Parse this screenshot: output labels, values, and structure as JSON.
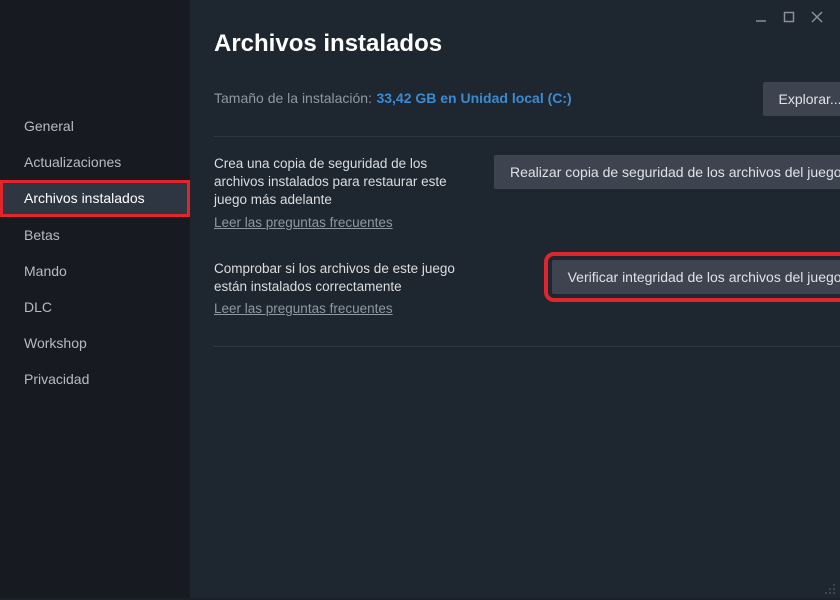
{
  "sidebar": {
    "items": [
      {
        "label": "General"
      },
      {
        "label": "Actualizaciones"
      },
      {
        "label": "Archivos instalados"
      },
      {
        "label": "Betas"
      },
      {
        "label": "Mando"
      },
      {
        "label": "DLC"
      },
      {
        "label": "Workshop"
      },
      {
        "label": "Privacidad"
      }
    ],
    "active_index": 2
  },
  "header": {
    "title": "Archivos instalados"
  },
  "install": {
    "label": "Tamaño de la instalación:",
    "value": "33,42 GB en Unidad local (C:)",
    "browse_button": "Explorar..."
  },
  "backup": {
    "desc": "Crea una copia de seguridad de los archivos instalados para restaurar este juego más adelante",
    "faq_link": "Leer las preguntas frecuentes",
    "button": "Realizar copia de seguridad de los archivos del juego"
  },
  "verify": {
    "desc": "Comprobar si los archivos de este juego están instalados correctamente",
    "faq_link": "Leer las preguntas frecuentes",
    "button": "Verificar integridad de los archivos del juego"
  }
}
